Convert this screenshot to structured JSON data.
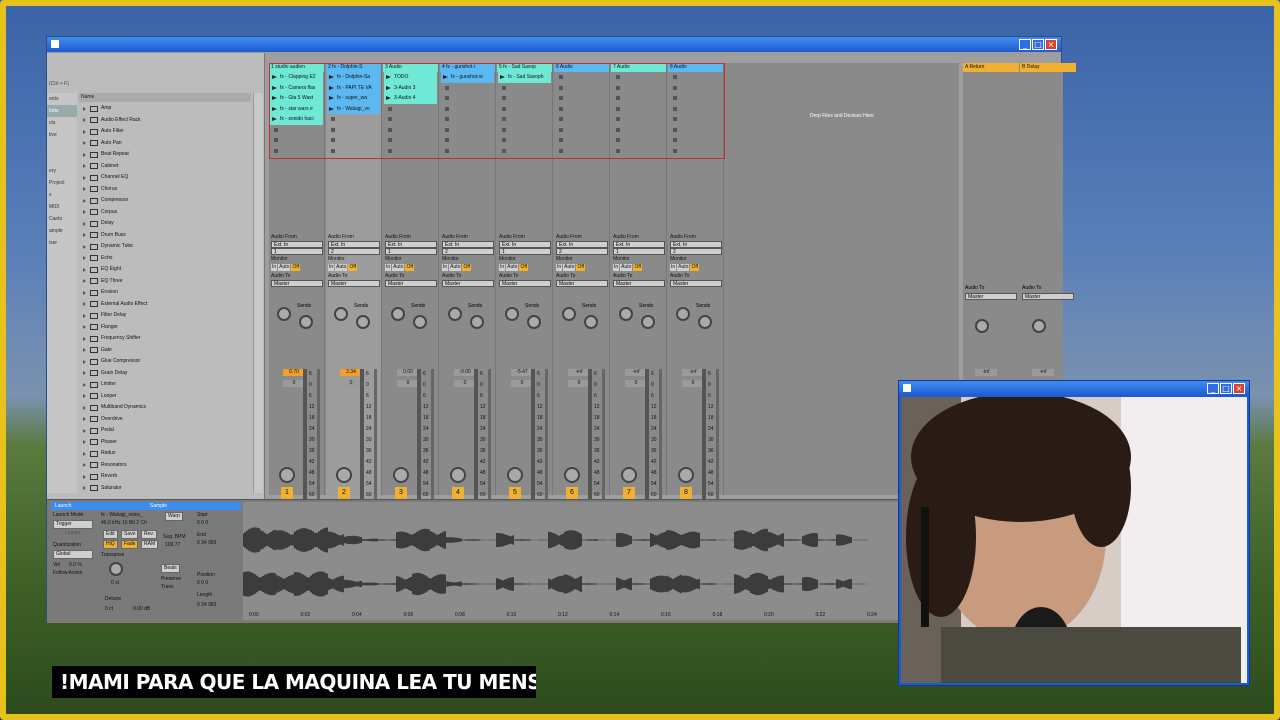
{
  "browser": {
    "search_placeholder": "(Ctrl + F)",
    "column_header": "Name",
    "left_labels": [
      "ents",
      "bots",
      "cts",
      "tive",
      "",
      "",
      "ery",
      "Project",
      "s",
      "MIDI",
      "Canto",
      "ample",
      "iser"
    ],
    "items": [
      "Amp",
      "Audio Effect Rack",
      "Auto Filter",
      "Auto Pan",
      "Beat Repeat",
      "Cabinet",
      "Channel EQ",
      "Chorus",
      "Compressor",
      "Corpus",
      "Delay",
      "Drum Buss",
      "Dynamic Tube",
      "Echo",
      "EQ Eight",
      "EQ Three",
      "Erosion",
      "External Audio Effect",
      "Filter Delay",
      "Flanger",
      "Frequency Shifter",
      "Gate",
      "Glue Compressor",
      "Grain Delay",
      "Limiter",
      "Looper",
      "Multiband Dynamics",
      "Overdrive",
      "Pedal",
      "Phaser",
      "Redux",
      "Resonators",
      "Reverb",
      "Saturator"
    ]
  },
  "tracks": [
    {
      "name": "1 studio audien",
      "color": "#6fe8d6",
      "clips": [
        "fx - Clapping E2",
        "fx - Camera flas",
        "fx - Gta 5 Wast",
        "fx - star wars e",
        "fx - sonido haci"
      ],
      "in": "Ext. In",
      "ch": "1",
      "vol": "0.70",
      "vol_hi": true,
      "num": "1"
    },
    {
      "name": "2 fx - Dolphin-S",
      "color": "#5bb8f0",
      "clips": [
        "fx - Dolphin-Sa",
        "fx - PAPI TE VA",
        "fx - super_wa",
        "fx - Waluigi_vo"
      ],
      "in": "Ext. In",
      "ch": "2",
      "vol": "2.34",
      "vol_hi": true,
      "num": "2"
    },
    {
      "name": "3 Audio",
      "color": "#6fe8d6",
      "clips": [
        "TODO",
        "3-Audio 3",
        "3-Audio 4"
      ],
      "in": "Ext. In",
      "ch": "1",
      "vol": "0.00",
      "vol_hi": false,
      "num": "3"
    },
    {
      "name": "4 fx - gunshot.r",
      "color": "#5bb8f0",
      "clips": [
        "fx - gunshot.re"
      ],
      "in": "Ext. In",
      "ch": "2",
      "vol": "-0.00",
      "vol_hi": false,
      "num": "4"
    },
    {
      "name": "5 fx - Sad Saxop",
      "color": "#6fe8d6",
      "clips": [
        "fx - Sad Saxoph"
      ],
      "in": "Ext. In",
      "ch": "1",
      "vol": "-5.47",
      "vol_hi": false,
      "num": "5"
    },
    {
      "name": "6 Audio",
      "color": "#5bb8f0",
      "clips": [],
      "in": "Ext. In",
      "ch": "2",
      "vol": "-inf",
      "vol_hi": false,
      "num": "6"
    },
    {
      "name": "7 Audio",
      "color": "#6fe8d6",
      "clips": [],
      "in": "Ext. In",
      "ch": "1",
      "vol": "-inf",
      "vol_hi": false,
      "num": "7"
    },
    {
      "name": "8 Audio",
      "color": "#5bb8f0",
      "clips": [],
      "in": "Ext. In",
      "ch": "2",
      "vol": "-inf",
      "vol_hi": false,
      "num": "8"
    }
  ],
  "returns": [
    {
      "name": "A Return",
      "vol": "-inf"
    },
    {
      "name": "B Delay",
      "vol": "-inf"
    }
  ],
  "mixer": {
    "audio_from": "Audio From",
    "monitor": "Monitor",
    "in": "In",
    "auto": "Auto",
    "off": "Off",
    "audio_to": "Audio To",
    "master": "Master",
    "sends": "Sends",
    "send_a": "A",
    "send_b": "B",
    "vol_zero": "0",
    "scale": [
      "6",
      "0",
      "6",
      "12",
      "18",
      "24",
      "30",
      "36",
      "42",
      "48",
      "54",
      "60"
    ]
  },
  "drop_text": "Drop Files and Devices Here",
  "detail": {
    "tab_launch": "Launch",
    "tab_sample": "Sample",
    "launch_mode_label": "Launch Mode",
    "launch_mode": "Trigger",
    "legato": "Legato",
    "quantization_label": "Quantization",
    "quantization": "Global",
    "vel_label": "Vel",
    "vel": "0.0 %",
    "follow_action": "Follow Action",
    "sample_name": "fx - Waluigi_voice_",
    "sample_info": "46.0 kHz 16 Bit 2 Ch",
    "edit": "Edit",
    "save": "Save",
    "rev": "Rev.",
    "hiq": "HiQ",
    "fade": "Fade",
    "ram": "RAM",
    "transpose": "Transpose",
    "transpose_val": "0 st",
    "detune": "Detune",
    "detune_val": "0 ct",
    "gain_val": "0.00 dB",
    "warp": "Warp",
    "seg_bpm_label": "Seg. BPM",
    "seg_bpm": "109.77",
    "beats": "Beats",
    "preserve": "Preserve",
    "trans": "Trans",
    "start": "Start",
    "end": "End",
    "position": "Position",
    "length": "Length",
    "start_val": "0   0   0",
    "end_val": "0  34  983",
    "length_val": "0  34  983",
    "position_val": "0   0   0",
    "ticks": [
      "0:00",
      "0:02",
      "0:04",
      "0:06",
      "0:08",
      "0:10",
      "0:12",
      "0:14",
      "0:16",
      "0:18",
      "0:20",
      "0:22",
      "0:24"
    ]
  },
  "caption": "!MAMI PARA QUE LA MAQUINA LEA TU MENSAJE ;)"
}
